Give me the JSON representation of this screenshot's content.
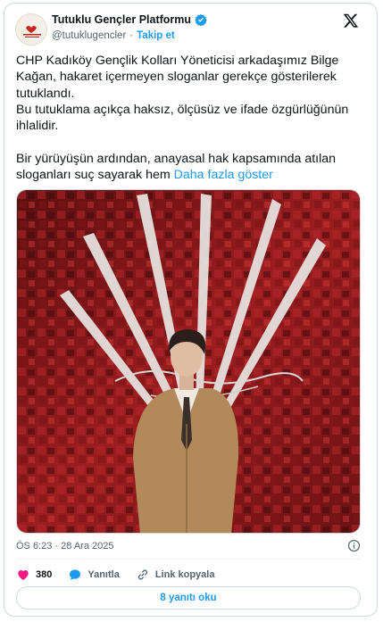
{
  "account": {
    "name": "Tutuklu Gençler Platformu",
    "handle": "@tutuklugencler",
    "separator": "·",
    "follow_label": "Takip et"
  },
  "tweet": {
    "paragraph1": "CHP Kadıköy Gençlik Kolları Yöneticisi arkadaşımız Bilge Kağan, hakaret içermeyen sloganlar gerekçe gösterilerek tutuklandı.",
    "paragraph2": "Bu tutuklama açıkça haksız, ölçüsüz ve ifade özgürlüğünün ihlalidir.",
    "paragraph3": "Bir yürüyüşün ardından, anayasal hak kapsamında atılan sloganları suç sayarak hem",
    "show_more": "Daha fazla göster"
  },
  "timestamp": "ÖS 6:23 · 28 Ara 2025",
  "actions": {
    "likes": "380",
    "reply_label": "Yanıtla",
    "copy_link_label": "Link kopyala"
  },
  "read_replies_label": "8 yanıtı oku",
  "colors": {
    "accent": "#1d9bf0",
    "like": "#f91880",
    "muted": "#536471"
  },
  "icons": [
    "verified-badge-icon",
    "x-logo-icon",
    "info-icon",
    "heart-icon",
    "reply-icon",
    "link-icon"
  ]
}
